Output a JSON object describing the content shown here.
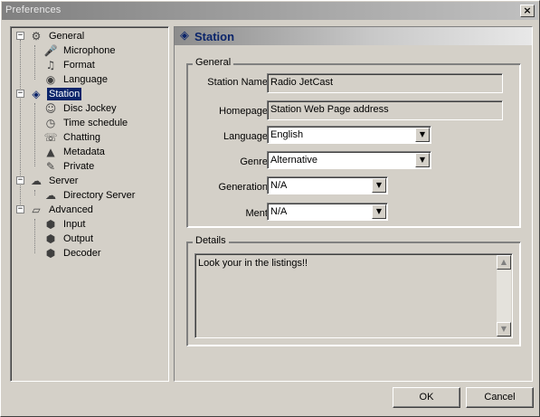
{
  "window": {
    "title": "Preferences",
    "close_glyph": "×"
  },
  "tree": [
    {
      "label": "General",
      "icon": "general-icon",
      "glyph": "⚙",
      "expander": "−",
      "level": 0
    },
    {
      "label": "Microphone",
      "icon": "microphone-icon",
      "glyph": "🎤",
      "level": 1
    },
    {
      "label": "Format",
      "icon": "format-icon",
      "glyph": "♫",
      "level": 1
    },
    {
      "label": "Language",
      "icon": "language-icon",
      "glyph": "◉",
      "level": 1
    },
    {
      "label": "Station",
      "icon": "station-icon",
      "glyph": "◈",
      "expander": "−",
      "level": 0,
      "selected": true
    },
    {
      "label": "Disc Jockey",
      "icon": "disc-jockey-icon",
      "glyph": "☺",
      "level": 1
    },
    {
      "label": "Time schedule",
      "icon": "time-schedule-icon",
      "glyph": "◷",
      "level": 1
    },
    {
      "label": "Chatting",
      "icon": "chatting-icon",
      "glyph": "☏",
      "level": 1
    },
    {
      "label": "Metadata",
      "icon": "metadata-icon",
      "glyph": "▲",
      "level": 1
    },
    {
      "label": "Private",
      "icon": "private-icon",
      "glyph": "✎",
      "level": 1
    },
    {
      "label": "Server",
      "icon": "server-icon",
      "glyph": "☁",
      "expander": "−",
      "level": 0
    },
    {
      "label": "Directory Server",
      "icon": "directory-server-icon",
      "glyph": "☁",
      "level": 1
    },
    {
      "label": "Advanced",
      "icon": "advanced-icon",
      "glyph": "▱",
      "expander": "−",
      "level": 0
    },
    {
      "label": "Input",
      "icon": "input-icon",
      "glyph": "⬢",
      "level": 1
    },
    {
      "label": "Output",
      "icon": "output-icon",
      "glyph": "⬢",
      "level": 1
    },
    {
      "label": "Decoder",
      "icon": "decoder-icon",
      "glyph": "⬢",
      "level": 1
    }
  ],
  "panel": {
    "title": "Station",
    "header_glyph": "◈"
  },
  "general_group": {
    "legend": "General",
    "station_name_label": "Station Name:",
    "station_name_value": "Radio JetCast",
    "homepage_label": "Homepage:",
    "homepage_value": "Station Web Page address",
    "language_label": "Language:",
    "language_value": "English",
    "genre_label": "Genre:",
    "genre_value": "Alternative",
    "generation_label": "Generation:",
    "generation_value": "N/A",
    "ment_label": "Ment:",
    "ment_value": "N/A",
    "dropdown_glyph": "▼"
  },
  "details_group": {
    "legend": "Details",
    "text": "Look your in the listings!!",
    "scroll_up_glyph": "▲",
    "scroll_down_glyph": "▼"
  },
  "buttons": {
    "ok": "OK",
    "cancel": "Cancel"
  }
}
